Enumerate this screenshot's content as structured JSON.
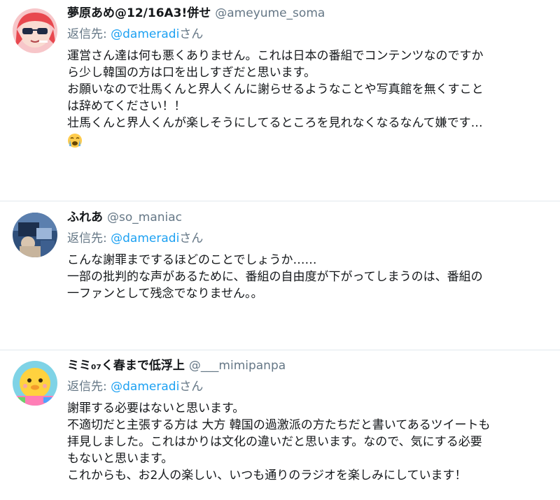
{
  "colors": {
    "link": "#1da1f2",
    "secondary": "#657786",
    "text": "#14171a",
    "divider": "#e1e8ed"
  },
  "tweets": [
    {
      "name": "夢原あめ@12/16A3!併せ",
      "handle": "@ameyume_soma",
      "reply_prefix": "返信先:",
      "reply_to": "@dameradi",
      "reply_suffix": "さん",
      "lines": [
        "運営さん達は何も悪くありません。これは日本の番組でコンテンツなのですか",
        "ら少し韓国の方は口を出しすぎだと思います。",
        "お願いなので壮馬くんと界人くんに謝らせるようなことや写真館を無くすこと",
        "は辞めてください！！",
        "壮馬くんと界人くんが楽しそうにしてるところを見れなくなるなんて嫌です…"
      ],
      "emoji": "crying-face"
    },
    {
      "name": "ふれあ",
      "handle": "@so_maniac",
      "reply_prefix": "返信先:",
      "reply_to": "@dameradi",
      "reply_suffix": "さん",
      "lines": [
        "こんな謝罪までするほどのことでしょうか……",
        "一部の批判的な声があるために、番組の自由度が下がってしまうのは、番組の",
        "一ファンとして残念でなりません。。"
      ]
    },
    {
      "name": "ミミ₀₇く春まで低浮上",
      "handle": "@___mimipanpa",
      "reply_prefix": "返信先:",
      "reply_to": "@dameradi",
      "reply_suffix": "さん",
      "lines": [
        "謝罪する必要はないと思います。",
        "不適切だと主張する方は 大方 韓国の過激派の方たちだと書いてあるツイートも",
        "拝見しました。これはかりは文化の違いだと思います。なので、気にする必要",
        "もないと思います。",
        "これからも、お2人の楽しい、いつも通りのラジオを楽しみにしています！"
      ]
    }
  ]
}
